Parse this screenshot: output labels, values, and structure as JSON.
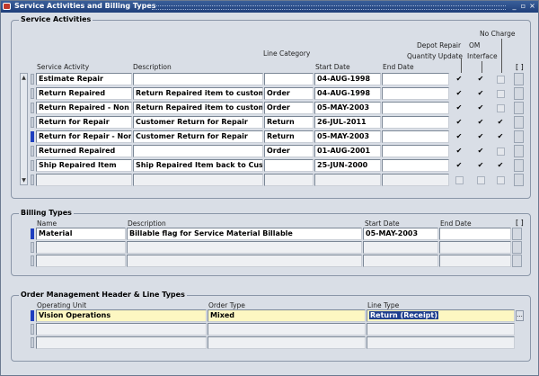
{
  "window": {
    "title": "Service Activities and Billing Types"
  },
  "service_activities": {
    "group_label": "Service Activities",
    "headers": {
      "service_activity": "Service Activity",
      "description": "Description",
      "line_category": "Line Category",
      "start_date": "Start Date",
      "end_date": "End Date",
      "depot_repair": "Depot Repair",
      "quantity_update": "Quantity Update",
      "no_charge": "No Charge",
      "om": "OM",
      "interface": "Interface",
      "folder": "[ ]"
    },
    "rows": [
      {
        "activity": "Estimate Repair",
        "description": "",
        "line_category": "",
        "start_date": "04-AUG-1998",
        "end_date": "",
        "qty": true,
        "om": true,
        "nocharge": false
      },
      {
        "activity": "Return Repaired",
        "description": "Return Repaired item to customer",
        "line_category": "Order",
        "start_date": "04-AUG-1998",
        "end_date": "",
        "qty": true,
        "om": true,
        "nocharge": false
      },
      {
        "activity": "Return Repaired - Non IB",
        "description": "Return Repaired item to customer",
        "line_category": "Order",
        "start_date": "05-MAY-2003",
        "end_date": "",
        "qty": true,
        "om": true,
        "nocharge": false
      },
      {
        "activity": "Return for Repair",
        "description": "Customer Return for Repair",
        "line_category": "Return",
        "start_date": "26-JUL-2011",
        "end_date": "",
        "qty": true,
        "om": true,
        "nocharge": true
      },
      {
        "activity": "Return for Repair - Non IB",
        "description": "Customer Return for Repair",
        "line_category": "Return",
        "start_date": "05-MAY-2003",
        "end_date": "",
        "qty": true,
        "om": true,
        "nocharge": true
      },
      {
        "activity": "Returned Repaired",
        "description": "",
        "line_category": "Order",
        "start_date": "01-AUG-2001",
        "end_date": "",
        "qty": true,
        "om": true,
        "nocharge": false
      },
      {
        "activity": "Ship Repaired Item",
        "description": "Ship Repaired Item back to Customer",
        "line_category": "",
        "start_date": "25-JUN-2000",
        "end_date": "",
        "qty": true,
        "om": true,
        "nocharge": true
      },
      {
        "activity": "",
        "description": "",
        "line_category": "",
        "start_date": "",
        "end_date": "",
        "qty": null,
        "om": null,
        "nocharge": null
      }
    ]
  },
  "billing_types": {
    "group_label": "Billing Types",
    "headers": {
      "name": "Name",
      "description": "Description",
      "start_date": "Start Date",
      "end_date": "End Date",
      "folder": "[ ]"
    },
    "rows": [
      {
        "name": "Material",
        "description": "Billable flag for Service Material Billable",
        "start_date": "05-MAY-2003",
        "end_date": ""
      },
      {
        "name": "",
        "description": "",
        "start_date": "",
        "end_date": ""
      },
      {
        "name": "",
        "description": "",
        "start_date": "",
        "end_date": ""
      }
    ]
  },
  "order_mgmt": {
    "group_label": "Order Management Header & Line Types",
    "headers": {
      "operating_unit": "Operating Unit",
      "order_type": "Order Type",
      "line_type": "Line Type"
    },
    "rows": [
      {
        "operating_unit": "Vision Operations",
        "order_type": "Mixed",
        "line_type": "Return (Receipt)"
      },
      {
        "operating_unit": "",
        "order_type": "",
        "line_type": ""
      },
      {
        "operating_unit": "",
        "order_type": "",
        "line_type": ""
      }
    ],
    "lov_label": "..."
  },
  "icons": {
    "check": "✔",
    "scroll_up": "▲",
    "scroll_down": "▼"
  },
  "colors": {
    "titlebar": "#2a4c88",
    "current_record": "#1f3fbf",
    "required_field": "#fdf7c2"
  }
}
